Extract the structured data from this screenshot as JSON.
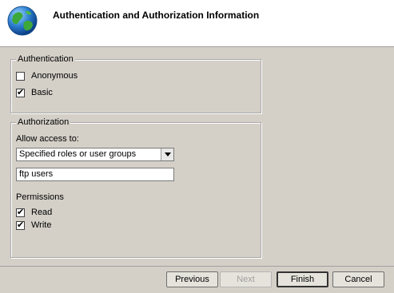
{
  "header": {
    "title": "Authentication and Authorization Information",
    "icon": "globe-icon"
  },
  "authentication": {
    "legend": "Authentication",
    "anonymous": {
      "label": "Anonymous",
      "checked": false
    },
    "basic": {
      "label": "Basic",
      "checked": true
    }
  },
  "authorization": {
    "legend": "Authorization",
    "allow_label": "Allow access to:",
    "allow_selected": "Specified roles or user groups",
    "roles_value": "ftp users",
    "permissions_label": "Permissions",
    "read": {
      "label": "Read",
      "checked": true
    },
    "write": {
      "label": "Write",
      "checked": true
    }
  },
  "buttons": {
    "previous": "Previous",
    "next": "Next",
    "finish": "Finish",
    "cancel": "Cancel"
  }
}
